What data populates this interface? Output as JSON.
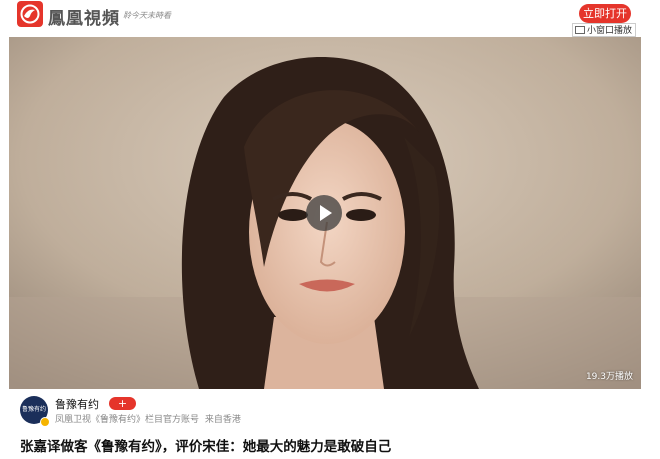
{
  "header": {
    "logo_icon": "phoenix-logo-icon",
    "logo_text": "鳳凰視頻",
    "slogan": "聆今天未時看",
    "open_button": "立即打开",
    "mini_window_button": "小窗口播放",
    "brand_color": "#e5352b"
  },
  "video": {
    "play_icon": "play-icon",
    "views": "19.3万播放"
  },
  "channel": {
    "avatar_text": "鲁豫有约",
    "name": "鲁豫有约",
    "follow_label": "+",
    "description": "凤凰卫视《鲁豫有约》栏目官方账号",
    "location": "来自香港"
  },
  "title": "张嘉译做客《鲁豫有约》，评价宋佳：她最大的魅力是敢破自己"
}
